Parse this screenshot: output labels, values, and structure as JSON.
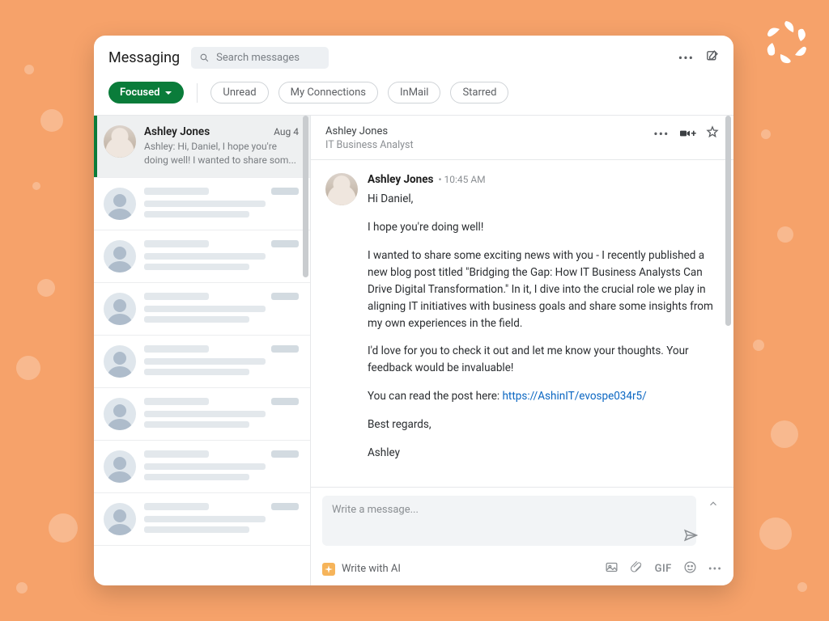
{
  "header": {
    "title": "Messaging",
    "search_placeholder": "Search messages"
  },
  "filters": {
    "focused": "Focused",
    "items": [
      "Unread",
      "My Connections",
      "InMail",
      "Starred"
    ]
  },
  "conversations": {
    "selected": {
      "name": "Ashley Jones",
      "date": "Aug 4",
      "preview": "Ashley: Hi, Daniel, I hope you're doing well! I wanted to share som..."
    }
  },
  "detail": {
    "name": "Ashley Jones",
    "subtitle": "IT Business Analyst",
    "message": {
      "sender": "Ashley Jones",
      "time": "10:45 AM",
      "greeting": "Hi Daniel,",
      "line1": "I hope you're doing well!",
      "para1": "I wanted to share some exciting news with you - I recently published a new blog post titled \"Bridging the Gap: How IT Business Analysts Can Drive Digital Transformation.\" In it, I dive into the crucial role we play in aligning IT initiatives with business goals and share some insights from my own experiences in the field.",
      "para2": "I'd love for you to check it out and let me know your thoughts. Your feedback would be invaluable!",
      "link_intro": "You can read the post here: ",
      "link_text": "https://AshinIT/evospe034r5/",
      "signoff": "Best regards,",
      "signature": "Ashley"
    }
  },
  "composer": {
    "placeholder": "Write a message...",
    "write_ai": "Write with AI",
    "gif_label": "GIF"
  }
}
